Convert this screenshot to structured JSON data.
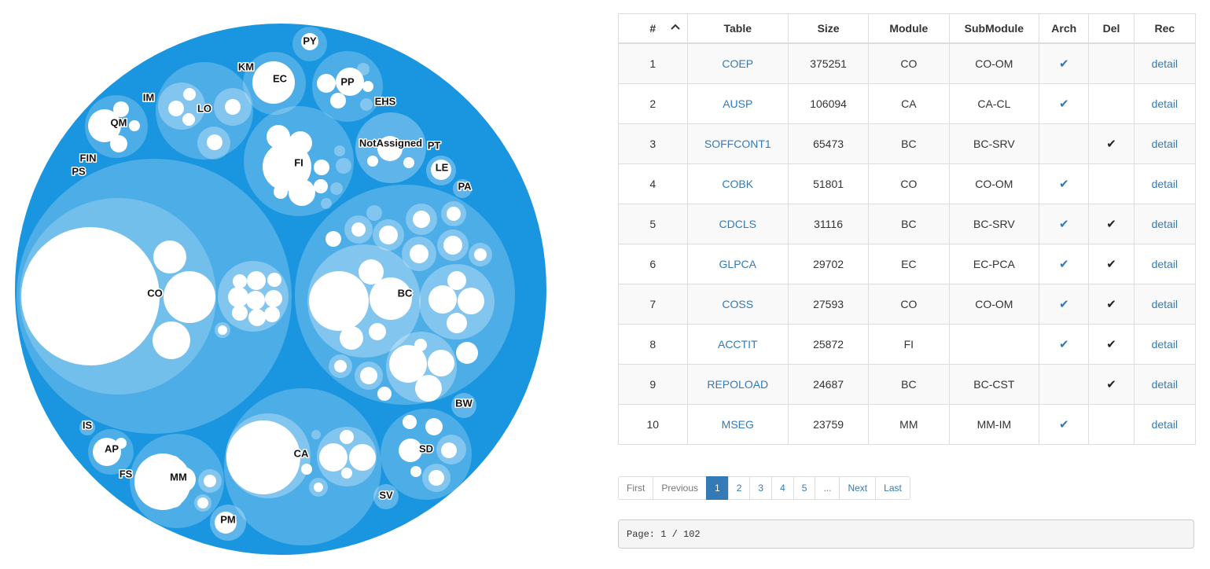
{
  "colors": {
    "outer_circle": "#1a96e0",
    "link": "#337ab7",
    "active_page": "#337ab7"
  },
  "pack_labels": {
    "co": "CO",
    "bc": "BC",
    "fi": "FI",
    "ca": "CA",
    "mm": "MM",
    "sd": "SD",
    "lo": "LO",
    "ec": "EC",
    "pp": "PP",
    "qm": "QM",
    "notassigned": "NotAssigned",
    "py": "PY",
    "km": "KM",
    "im": "IM",
    "ehs": "EHS",
    "pt": "PT",
    "le": "LE",
    "pa": "PA",
    "fin": "FIN",
    "ps": "PS",
    "bw": "BW",
    "is": "IS",
    "ap": "AP",
    "fs": "FS",
    "sv": "SV",
    "pm": "PM"
  },
  "table": {
    "headers": {
      "num": "#",
      "table": "Table",
      "size": "Size",
      "module": "Module",
      "submodule": "SubModule",
      "arch": "Arch",
      "del": "Del",
      "rec": "Rec"
    },
    "rows": [
      {
        "num": "1",
        "table": "COEP",
        "size": "375251",
        "module": "CO",
        "submodule": "CO-OM",
        "arch": true,
        "del": false,
        "rec": "detail"
      },
      {
        "num": "2",
        "table": "AUSP",
        "size": "106094",
        "module": "CA",
        "submodule": "CA-CL",
        "arch": true,
        "del": false,
        "rec": "detail"
      },
      {
        "num": "3",
        "table": "SOFFCONT1",
        "size": "65473",
        "module": "BC",
        "submodule": "BC-SRV",
        "arch": false,
        "del": true,
        "rec": "detail"
      },
      {
        "num": "4",
        "table": "COBK",
        "size": "51801",
        "module": "CO",
        "submodule": "CO-OM",
        "arch": true,
        "del": false,
        "rec": "detail"
      },
      {
        "num": "5",
        "table": "CDCLS",
        "size": "31116",
        "module": "BC",
        "submodule": "BC-SRV",
        "arch": true,
        "del": true,
        "rec": "detail"
      },
      {
        "num": "6",
        "table": "GLPCA",
        "size": "29702",
        "module": "EC",
        "submodule": "EC-PCA",
        "arch": true,
        "del": true,
        "rec": "detail"
      },
      {
        "num": "7",
        "table": "COSS",
        "size": "27593",
        "module": "CO",
        "submodule": "CO-OM",
        "arch": true,
        "del": true,
        "rec": "detail"
      },
      {
        "num": "8",
        "table": "ACCTIT",
        "size": "25872",
        "module": "FI",
        "submodule": "",
        "arch": true,
        "del": true,
        "rec": "detail"
      },
      {
        "num": "9",
        "table": "REPOLOAD",
        "size": "24687",
        "module": "BC",
        "submodule": "BC-CST",
        "arch": false,
        "del": true,
        "rec": "detail"
      },
      {
        "num": "10",
        "table": "MSEG",
        "size": "23759",
        "module": "MM",
        "submodule": "MM-IM",
        "arch": true,
        "del": false,
        "rec": "detail"
      }
    ]
  },
  "pagination": {
    "first": "First",
    "previous": "Previous",
    "pages": [
      "1",
      "2",
      "3",
      "4",
      "5",
      "..."
    ],
    "active_page": "1",
    "next": "Next",
    "last": "Last"
  },
  "page_info": "Page: 1 / 102"
}
